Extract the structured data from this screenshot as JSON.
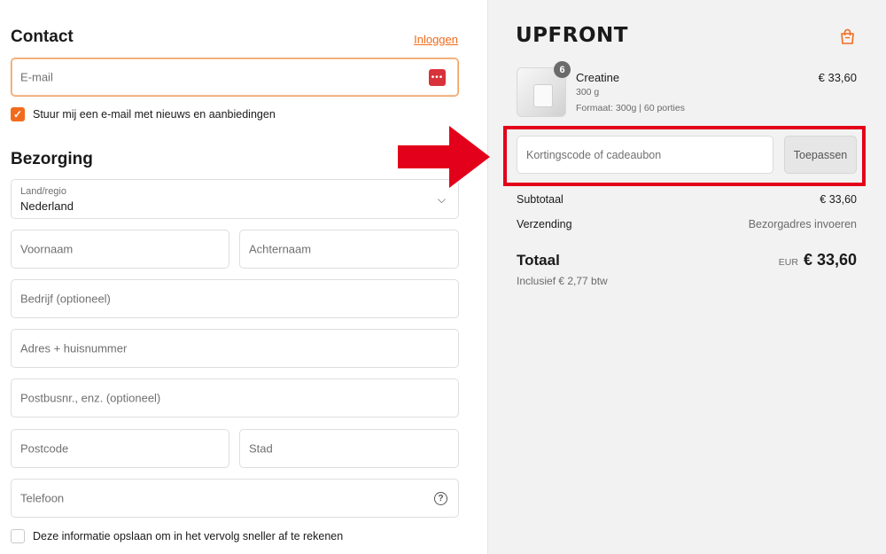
{
  "contact": {
    "heading": "Contact",
    "login_link": "Inloggen",
    "email_placeholder": "E-mail",
    "password_manager_icon": "password-manager-icon",
    "newsletter_label": "Stuur mij een e-mail met nieuws en aanbiedingen",
    "newsletter_checked": true
  },
  "delivery": {
    "heading": "Bezorging",
    "country_label": "Land/regio",
    "country_value": "Nederland",
    "first_name_placeholder": "Voornaam",
    "last_name_placeholder": "Achternaam",
    "company_placeholder": "Bedrijf (optioneel)",
    "address_placeholder": "Adres + huisnummer",
    "address2_placeholder": "Postbusnr., enz. (optioneel)",
    "postcode_placeholder": "Postcode",
    "city_placeholder": "Stad",
    "phone_placeholder": "Telefoon",
    "save_info_label": "Deze informatie opslaan om in het vervolg sneller af te rekenen",
    "save_info_checked": false
  },
  "summary": {
    "brand": "UPFRONT",
    "cart_icon": "shopping-bag-icon",
    "product": {
      "name": "Creatine",
      "weight": "300 g",
      "variant": "Formaat: 300g | 60 porties",
      "price": "€ 33,60",
      "quantity": "6"
    },
    "discount_placeholder": "Kortingscode of cadeaubon",
    "apply_button": "Toepassen",
    "subtotal_label": "Subtotaal",
    "subtotal_value": "€ 33,60",
    "shipping_label": "Verzending",
    "shipping_value": "Bezorgadres invoeren",
    "total_label": "Totaal",
    "total_currency": "EUR",
    "total_value": "€ 33,60",
    "tax_line": "Inclusief € 2,77 btw"
  },
  "annotation": {
    "arrow_color": "#e3001b",
    "highlight_color": "#e3001b"
  },
  "colors": {
    "accent": "#f26b1d",
    "summary_background": "#f2f2f2"
  }
}
